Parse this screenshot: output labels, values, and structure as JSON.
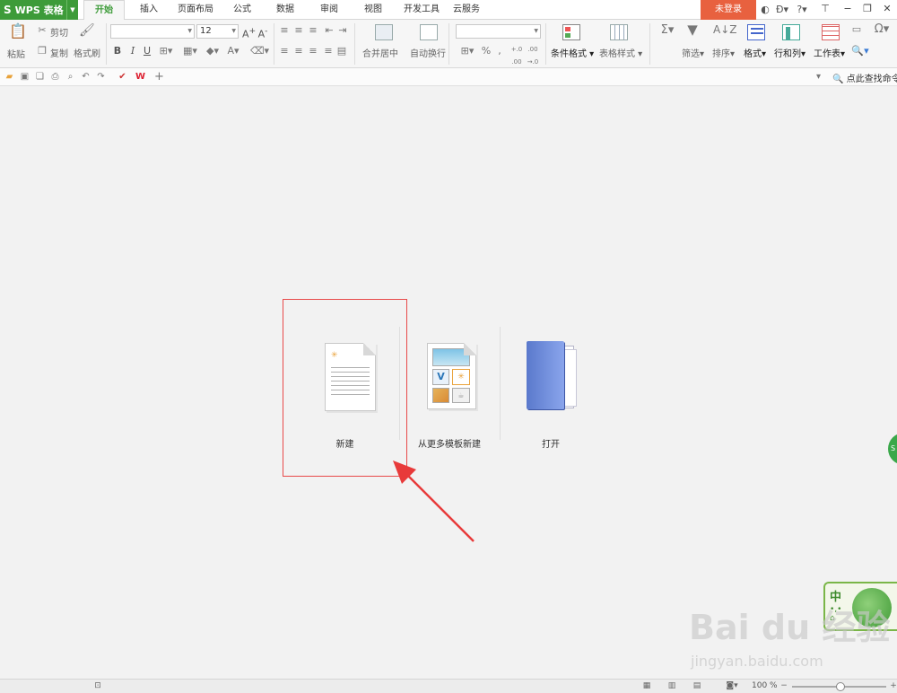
{
  "app": {
    "logo": "S",
    "name": "WPS 表格"
  },
  "menu_tabs": [
    {
      "label": "开始",
      "active": true
    },
    {
      "label": "插入"
    },
    {
      "label": "页面布局"
    },
    {
      "label": "公式"
    },
    {
      "label": "数据"
    },
    {
      "label": "审阅"
    },
    {
      "label": "视图"
    },
    {
      "label": "开发工具"
    },
    {
      "label": "云服务"
    }
  ],
  "login_label": "未登录",
  "ribbon": {
    "paste": "粘贴",
    "cut": "剪切",
    "copy": "复制",
    "format_painter": "格式刷",
    "font_size": "12",
    "bold": "B",
    "italic": "I",
    "underline": "U",
    "merge_center": "合并居中",
    "auto_wrap": "自动换行",
    "percent": "%",
    "cond_format": "条件格式",
    "table_style": "表格样式",
    "filter": "筛选",
    "sort": "排序",
    "format": "格式",
    "row_col": "行和列",
    "worksheet": "工作表"
  },
  "quick_access": {
    "find_command": "点此查找命令"
  },
  "start_page": {
    "new_label": "新建",
    "template_label": "从更多模板新建",
    "open_label": "打开"
  },
  "side": {
    "ime_char": "中"
  },
  "watermark": {
    "main": "Bai du 经验",
    "sub": "jingyan.baidu.com"
  },
  "status": {
    "zoom": "100 %"
  },
  "colors": {
    "accent": "#3d9b39",
    "login": "#e8613f",
    "highlight": "#e84a4a"
  }
}
